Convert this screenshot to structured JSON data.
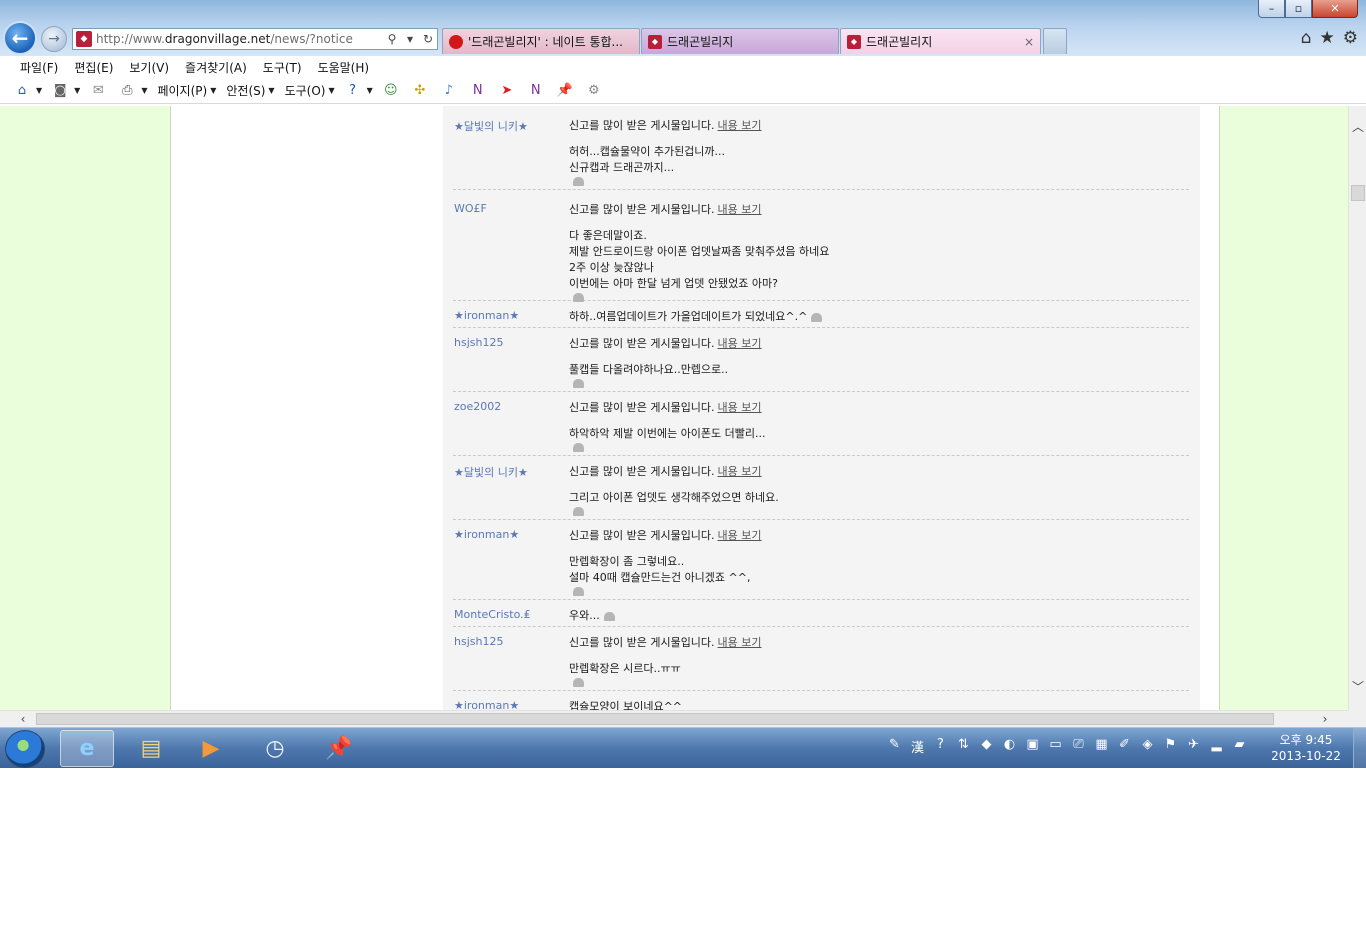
{
  "browser": {
    "address_url_prefix": "http://www.",
    "address_url_domain": "dragonvillage.net",
    "address_url_path": "/news/?notice",
    "tabs": [
      {
        "label": "'드래곤빌리지' : 네이트 통합..."
      },
      {
        "label": "드래곤빌리지"
      },
      {
        "label": "드래곤빌리지",
        "close": "×"
      }
    ],
    "window_buttons": {
      "minimize": "–",
      "maximize": "▫",
      "close": "✕"
    }
  },
  "menu": [
    "파일(F)",
    "편집(E)",
    "보기(V)",
    "즐겨찾기(A)",
    "도구(T)",
    "도움말(H)"
  ],
  "command_bar": {
    "page": "페이지(P)",
    "safety": "안전(S)",
    "tools": "도구(O)"
  },
  "comments": {
    "more_label": "내용 보기",
    "reported_text": "신고를 많이 받은 게시물입니다.",
    "items": [
      {
        "author": "★달빛의 니키★",
        "reported": true,
        "text": "허허...캡슐물약이 추가된겁니까...\n신규캡과 드래곤까지..."
      },
      {
        "author": "WO£F",
        "reported": true,
        "text": "다 좋은데말이죠.\n제발 안드로이드랑 아이폰 업뎃날짜좀 맞춰주셨음 하네요\n2주 이상 늦잖않나\n이번에는 아마 한달 넘게 업뎃 안됐었죠 아마?"
      },
      {
        "author": "★ironman★",
        "reported": false,
        "text": "하하..여름업데이트가 가을업데이트가 되었네요^.^"
      },
      {
        "author": "hsjsh125",
        "reported": true,
        "text": "풀캡들 다올려야하나요..만렙으로.."
      },
      {
        "author": "zoe2002",
        "reported": true,
        "text": "하악하악 제발 이번에는 아이폰도 더빨리..."
      },
      {
        "author": "★달빛의 니키★",
        "reported": true,
        "text": "그리고 아이폰 업뎃도 생각해주었으면 하네요."
      },
      {
        "author": "★ironman★",
        "reported": true,
        "text": "만렙확장이 좀 그렇네요..\n설마 40때 캡슐만드는건 아니겠죠 ^^,"
      },
      {
        "author": "MonteCristo.₤",
        "reported": false,
        "text": "우와..."
      },
      {
        "author": "hsjsh125",
        "reported": true,
        "text": "만렙확장은 시르다..ㅠㅠ"
      },
      {
        "author": "★ironman★",
        "reported": false,
        "text": "캡슐모양이 보이네요^^"
      }
    ]
  },
  "taskbar": {
    "time": "오후 9:45",
    "date": "2013-10-22"
  }
}
